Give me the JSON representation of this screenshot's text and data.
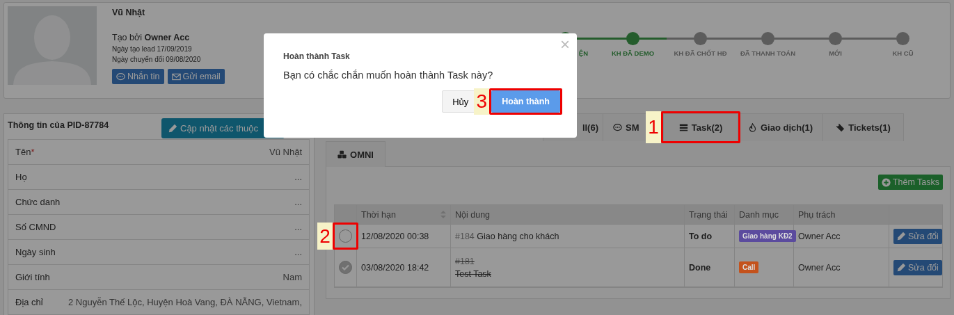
{
  "profile": {
    "name": "Vũ Nhật",
    "created_by_label": "Tạo bởi",
    "created_by": "Owner Acc",
    "lead_date": "Ngày tạo lead 17/09/2019",
    "convert_date": "Ngày chuyển đổi 09/08/2020",
    "buttons": [
      {
        "kind": "message",
        "label": "Nhắn tin"
      },
      {
        "kind": "email",
        "label": "Gửi email"
      }
    ]
  },
  "stages": [
    {
      "label": "ỆN",
      "done": true
    },
    {
      "label": "KH ĐÃ DEMO",
      "done": true
    },
    {
      "label": "KH ĐÃ CHỐT HĐ",
      "done": false
    },
    {
      "label": "ĐÃ THANH TOÁN",
      "done": false
    },
    {
      "label": "MỚI",
      "done": false
    },
    {
      "label": "KH CŨ",
      "done": false
    }
  ],
  "info_panel": {
    "title": "Thông tin của PID-87784",
    "update_button": "Cập nhật các thuộc",
    "fields": [
      {
        "label": "Tên",
        "required_mark": "*",
        "value": "Vũ Nhật"
      },
      {
        "label": "Họ",
        "value": "..."
      },
      {
        "label": "Chức danh",
        "value": "..."
      },
      {
        "label": "Số CMND",
        "value": "..."
      },
      {
        "label": "Ngày sinh",
        "value": "..."
      },
      {
        "label": "Giới tính",
        "value": "Nam"
      },
      {
        "label": "Địa chỉ",
        "value": "2 Nguyễn Thế Lộc, Huyện Hoà Vang, ĐÀ NẴNG, Vietnam,"
      }
    ]
  },
  "tabs": [
    {
      "kind": "mail",
      "label": "ll(6)"
    },
    {
      "kind": "sms",
      "label": "SM"
    },
    {
      "kind": "task",
      "label": "Task(2)",
      "callout": "1"
    },
    {
      "kind": "deal",
      "label": "Giao dịch(1)"
    },
    {
      "kind": "ticket",
      "label": "Tickets(1)"
    }
  ],
  "subtabs": [
    {
      "kind": "omni",
      "label": "OMNI"
    }
  ],
  "add_task_button": "Thêm Tasks",
  "task_table": {
    "columns": [
      "Thời hạn",
      "Nội dung",
      "Trạng thái",
      "Danh mục",
      "Phụ trách"
    ],
    "rows": [
      {
        "done": false,
        "callout": "2",
        "due": "12/08/2020 00:38",
        "ref": "#184",
        "text": "Giao hàng cho khách",
        "status": "To do",
        "category": "Giao hàng KĐ2",
        "color": "#5b4b9e",
        "owner": "Owner Acc",
        "edit": "Sửa đổi"
      },
      {
        "done": true,
        "due": "03/08/2020 18:42",
        "ref": "#181",
        "text": "Test Task",
        "status": "Done",
        "category": "Call",
        "color": "#c4521c",
        "owner": "Owner Acc",
        "edit": "Sửa đổi"
      }
    ]
  },
  "dialog": {
    "title": "Hoàn thành Task",
    "message": "Bạn có chắc chắn muốn hoàn thành Task này?",
    "close": "×",
    "cancel": "Hủy",
    "confirm": "Hoàn thành",
    "confirm_callout": "3"
  }
}
